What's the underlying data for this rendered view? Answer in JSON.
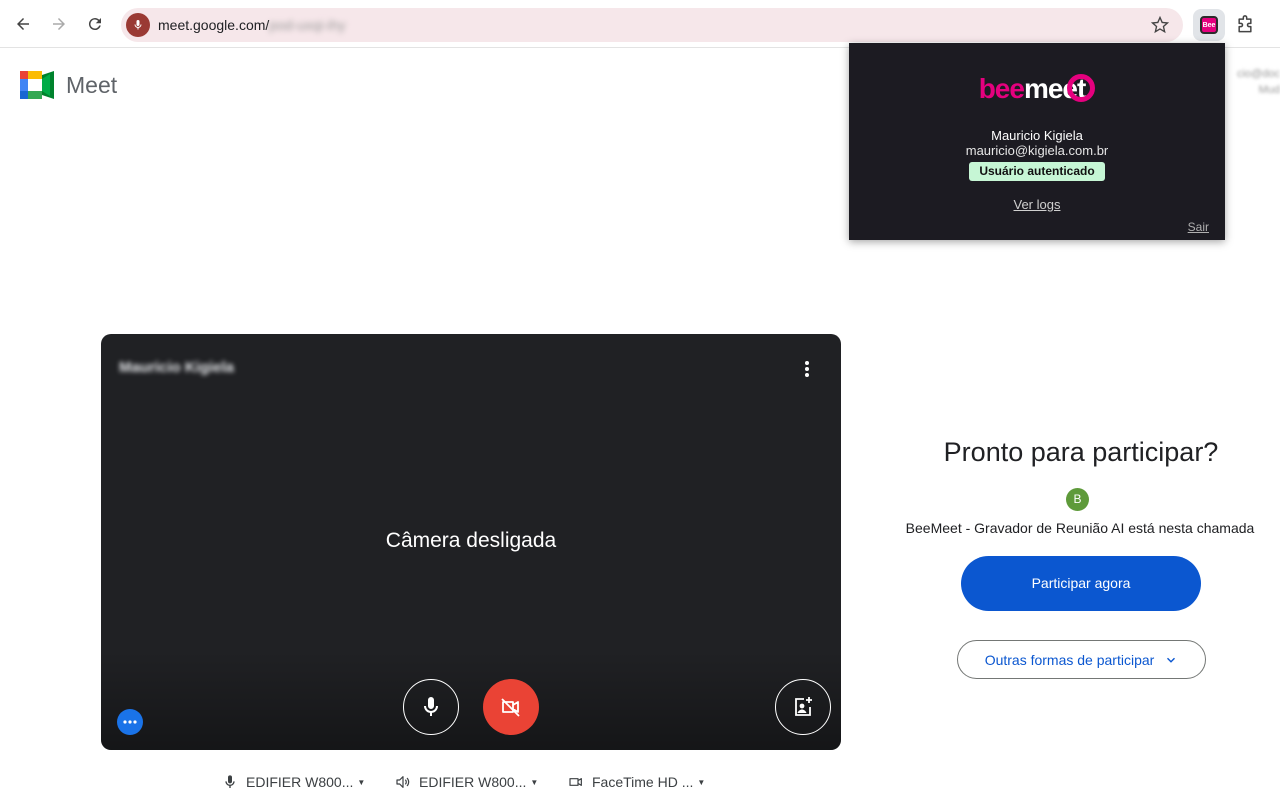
{
  "browser": {
    "url_visible": "meet.google.com/",
    "url_obscured": "pod-uxqi-ihy"
  },
  "meet": {
    "title": "Meet",
    "account_peek_line1": "cio@doc",
    "account_peek_line2": "Mud"
  },
  "popup": {
    "logo_bee": "bee",
    "logo_meet": "meet",
    "user_name": "Mauricio Kigiela",
    "user_email": "mauricio@kigiela.com.br",
    "status_badge": "Usuário autenticado",
    "logs_link": "Ver logs",
    "logout_link": "Sair",
    "colors": {
      "brand": "#e5007e",
      "background": "#1c1b22",
      "badge": "#c6f6d5"
    }
  },
  "video": {
    "participant_name": "Mauricio Kigiela",
    "camera_status": "Câmera desligada"
  },
  "devices": {
    "microphone": "EDIFIER W800...",
    "speaker": "EDIFIER W800...",
    "camera": "FaceTime HD ..."
  },
  "join": {
    "heading": "Pronto para participar?",
    "avatar_letter": "B",
    "in_call_text": "BeeMeet - Gravador de Reunião AI está nesta chamada",
    "join_button": "Participar agora",
    "other_options_button": "Outras formas de participar",
    "colors": {
      "primary": "#0b57d0",
      "avatar": "#5e9a3a",
      "camera_off_red": "#ea4335"
    }
  }
}
